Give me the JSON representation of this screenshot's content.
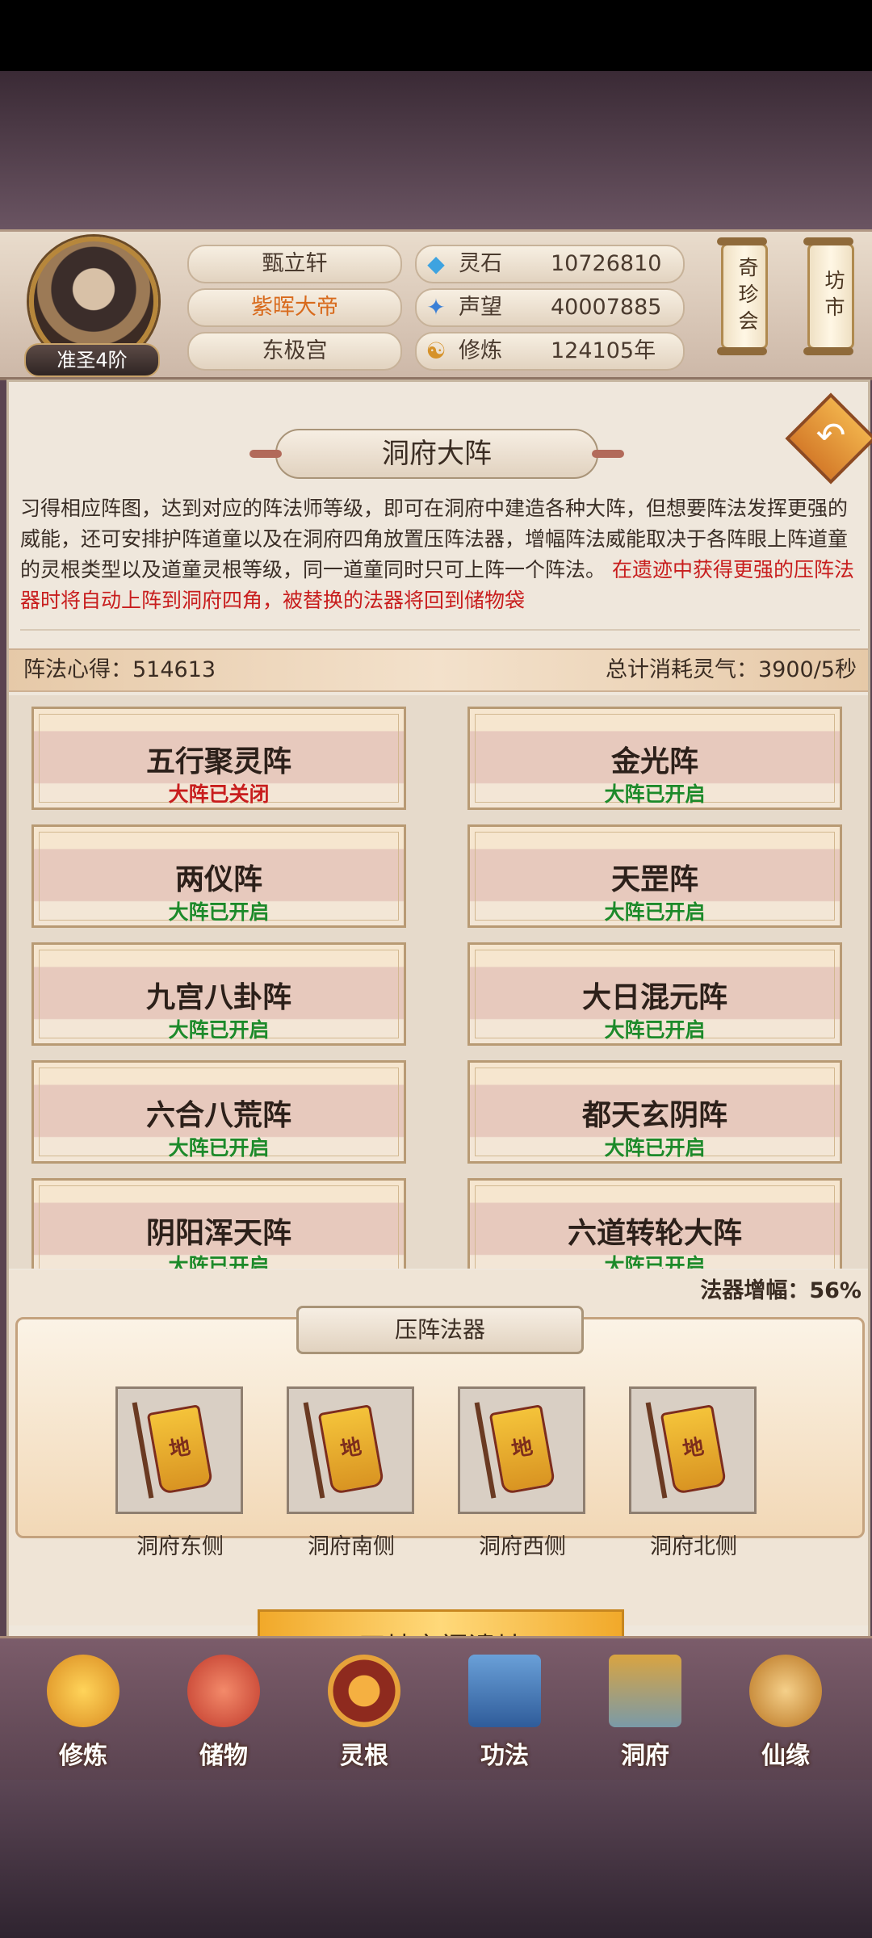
{
  "player": {
    "name": "甄立轩",
    "title": "紫晖大帝",
    "sect": "东极宫",
    "rank": "准圣4阶"
  },
  "stats": [
    {
      "icon": "crystal-icon",
      "label": "灵石",
      "value": "10726810"
    },
    {
      "icon": "fame-icon",
      "label": "声望",
      "value": "40007885"
    },
    {
      "icon": "meditate-icon",
      "label": "修炼",
      "value": "124105年"
    }
  ],
  "side_buttons": {
    "treasure": "奇珍会",
    "market": "坊市"
  },
  "page": {
    "title": "洞府大阵",
    "description": "习得相应阵图，达到对应的阵法师等级，即可在洞府中建造各种大阵，但想要阵法发挥更强的威能，还可安排护阵道童以及在洞府四角放置压阵法器，增幅阵法威能取决于各阵眼上阵道童的灵根类型以及道童灵根等级，同一道童同时只可上阵一个阵法。",
    "notice": "在遗迹中获得更强的压阵法器时将自动上阵到洞府四角，被替换的法器将回到储物袋",
    "insight": "阵法心得：514613",
    "cost": "总计消耗灵气：3900/5秒"
  },
  "formations": [
    {
      "name": "五行聚灵阵",
      "status": "大阵已关闭",
      "active": false
    },
    {
      "name": "金光阵",
      "status": "大阵已开启",
      "active": true
    },
    {
      "name": "两仪阵",
      "status": "大阵已开启",
      "active": true
    },
    {
      "name": "天罡阵",
      "status": "大阵已开启",
      "active": true
    },
    {
      "name": "九宫八卦阵",
      "status": "大阵已开启",
      "active": true
    },
    {
      "name": "大日混元阵",
      "status": "大阵已开启",
      "active": true
    },
    {
      "name": "六合八荒阵",
      "status": "大阵已开启",
      "active": true
    },
    {
      "name": "都天玄阴阵",
      "status": "大阵已开启",
      "active": true
    },
    {
      "name": "阴阳浑天阵",
      "status": "大阵已开启",
      "active": true
    },
    {
      "name": "六道转轮大阵",
      "status": "大阵已开启",
      "active": true
    }
  ],
  "artifacts": {
    "increase": "法器增幅：56%",
    "title": "压阵法器",
    "flag_char": "地",
    "slots": [
      "洞府东侧",
      "洞府南侧",
      "洞府西侧",
      "洞府北侧"
    ],
    "ruins_button": "天地玄门遗址"
  },
  "nav": [
    {
      "icon": "cultivate-icon",
      "label": "修炼"
    },
    {
      "icon": "storage-bag-icon",
      "label": "储物"
    },
    {
      "icon": "spirit-root-icon",
      "label": "灵根"
    },
    {
      "icon": "technique-book-icon",
      "label": "功法"
    },
    {
      "icon": "cave-abode-icon",
      "label": "洞府"
    },
    {
      "icon": "fate-gourd-icon",
      "label": "仙缘"
    }
  ]
}
